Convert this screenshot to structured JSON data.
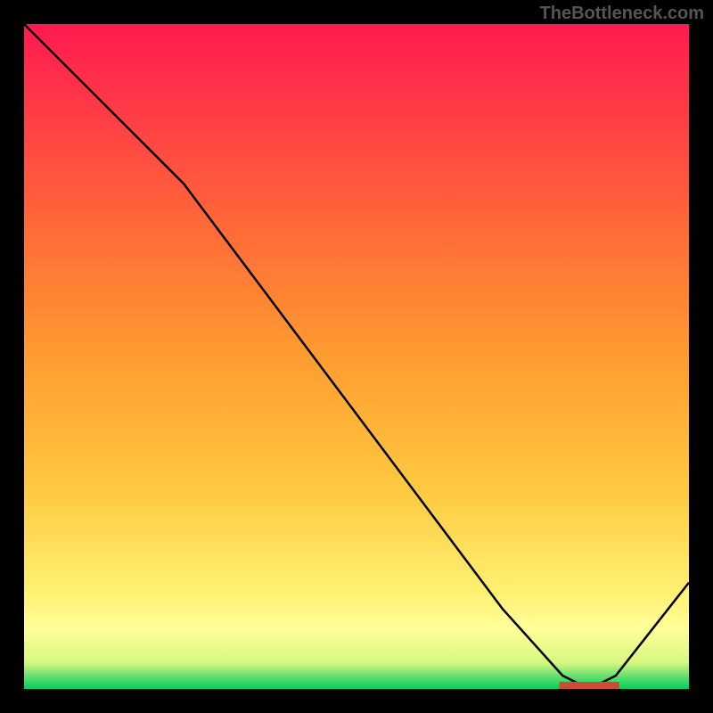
{
  "watermark": "TheBottleneck.com",
  "chart_data": {
    "type": "line",
    "title": "",
    "xlabel": "",
    "ylabel": "",
    "xlim": [
      0,
      100
    ],
    "ylim": [
      0,
      100
    ],
    "series": [
      {
        "name": "curve",
        "x": [
          0,
          12,
          24,
          36,
          48,
          60,
          72,
          81,
          85,
          89,
          100
        ],
        "values": [
          100,
          88,
          76,
          60,
          44,
          28,
          12,
          2,
          0,
          2,
          16
        ]
      }
    ],
    "gradient_stops": [
      {
        "offset": 0.0,
        "color": "#00d060"
      },
      {
        "offset": 0.02,
        "color": "#6ae070"
      },
      {
        "offset": 0.04,
        "color": "#d8f880"
      },
      {
        "offset": 0.09,
        "color": "#ffff99"
      },
      {
        "offset": 0.15,
        "color": "#ffef70"
      },
      {
        "offset": 0.3,
        "color": "#ffc940"
      },
      {
        "offset": 0.5,
        "color": "#ff9c30"
      },
      {
        "offset": 0.7,
        "color": "#ff6838"
      },
      {
        "offset": 0.85,
        "color": "#ff4045"
      },
      {
        "offset": 1.0,
        "color": "#ff1a50"
      }
    ],
    "marker": {
      "x": 85,
      "color": "#d04a3a",
      "width": 9
    }
  }
}
